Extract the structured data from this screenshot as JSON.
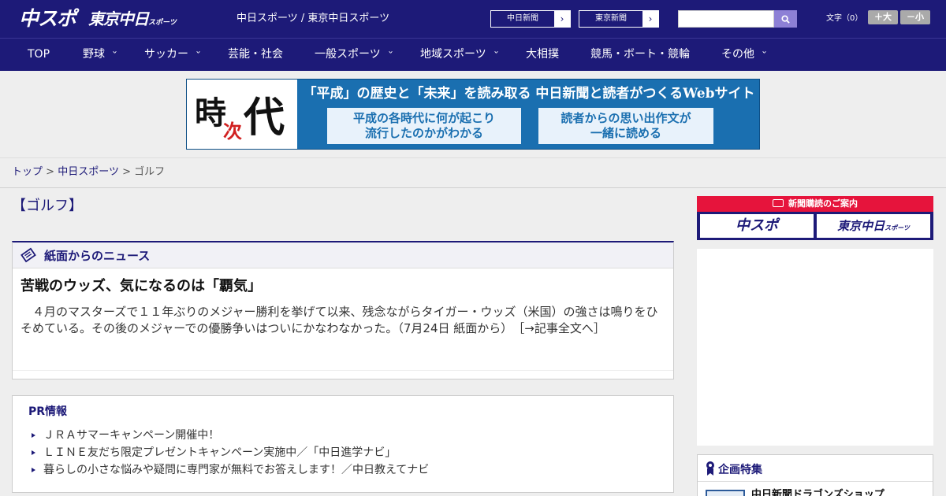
{
  "header": {
    "logo_chuspo": "中スポ",
    "logo_tokyo": "東京中日",
    "logo_tokyo_small": "スポーツ",
    "site_names": "中日スポーツ / 東京中日スポーツ",
    "ext_links": [
      {
        "label": "中日新聞"
      },
      {
        "label": "東京新聞"
      }
    ],
    "search_placeholder": "",
    "font_size_label": "文字（0）",
    "font_plus": "＋大",
    "font_minus": "－小",
    "colors": {
      "brand": "#1d1a78",
      "search_button": "#8d80d6"
    }
  },
  "nav": {
    "items": [
      {
        "label": "TOP"
      },
      {
        "label": "野球"
      },
      {
        "label": "サッカー"
      },
      {
        "label": "芸能・社会"
      },
      {
        "label": "一般スポーツ"
      },
      {
        "label": "地域スポーツ"
      },
      {
        "label": "大相撲"
      },
      {
        "label": "競馬・ボート・競輪"
      },
      {
        "label": "その他"
      }
    ]
  },
  "banner": {
    "logo_char_1": "時",
    "logo_char_2": "代",
    "logo_char_sub": "次",
    "headline": "「平成」の歴史と「未来」を読み取る 中日新聞と読者がつくるWebサイト",
    "box1_line1": "平成の各時代に何が起こり",
    "box1_line2": "流行したのかがわかる",
    "box2_line1": "読者からの思い出作文が",
    "box2_line2": "一緒に読める"
  },
  "breadcrumb": {
    "top": "トップ",
    "sep": ">",
    "chunichi": "中日スポーツ",
    "current": "ゴルフ"
  },
  "category_title": "【ゴルフ】",
  "news": {
    "section_label": "紙面からのニュース",
    "title": "苦戦のウッズ、気になるのは「覇気」",
    "body": "　４月のマスターズで１１年ぶりのメジャー勝利を挙げて以来、残念ながらタイガー・ウッズ（米国）の強さは鳴りをひそめている。その後のメジャーでの優勝争いはついにかなわなかった。（7月24日 紙面から）",
    "read_more": "［→記事全文へ］"
  },
  "pr": {
    "heading": "PR情報",
    "items": [
      "ＪＲＡサマーキャンペーン開催中！",
      "ＬＩＮＥ友だち限定プレゼントキャンペーン実施中／「中日進学ナビ」",
      "暮らしの小さな悩みや疑問に専門家が無料でお答えします！／中日教えてナビ"
    ]
  },
  "sidebar": {
    "subscribe_head": "新聞購読のご案内",
    "subscribe_btn1": "中スポ",
    "subscribe_btn2": "東京中日",
    "subscribe_btn2_small": "スポーツ",
    "feature_title": "企画特集",
    "feature_item": "中日新聞ドラゴンズショップ"
  }
}
